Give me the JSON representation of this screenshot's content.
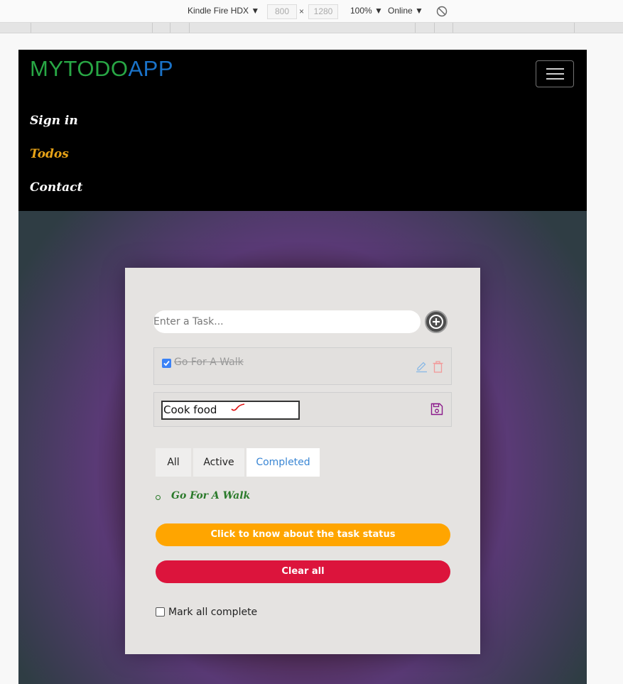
{
  "devtools": {
    "device": "Kindle Fire HDX ▼",
    "width": "800",
    "height": "1280",
    "times": "×",
    "zoom": "100% ▼",
    "network": "Online ▼"
  },
  "navbar": {
    "brand_part1": "MYTODO",
    "brand_part2": "APP",
    "links": [
      {
        "label": "Sign in",
        "active": false
      },
      {
        "label": "Todos",
        "active": true
      },
      {
        "label": "Contact",
        "active": false
      }
    ]
  },
  "todo": {
    "input_placeholder": "Enter a Task...",
    "items": [
      {
        "text": "Go For A Walk",
        "completed": true
      },
      {
        "text": "Cook food",
        "editing": true
      }
    ],
    "filters": [
      "All",
      "Active",
      "Completed"
    ],
    "selected_filter": "Completed",
    "completed_list": [
      "Go For A Walk"
    ],
    "status_button": "Click to know about the task status",
    "clear_button": "Clear all",
    "mark_all_label": "Mark all complete"
  },
  "colors": {
    "brand_green": "#28a745",
    "brand_blue": "#1a73c9",
    "active_link": "#e8a317",
    "orange": "#ffa500",
    "crimson": "#dc143c"
  }
}
